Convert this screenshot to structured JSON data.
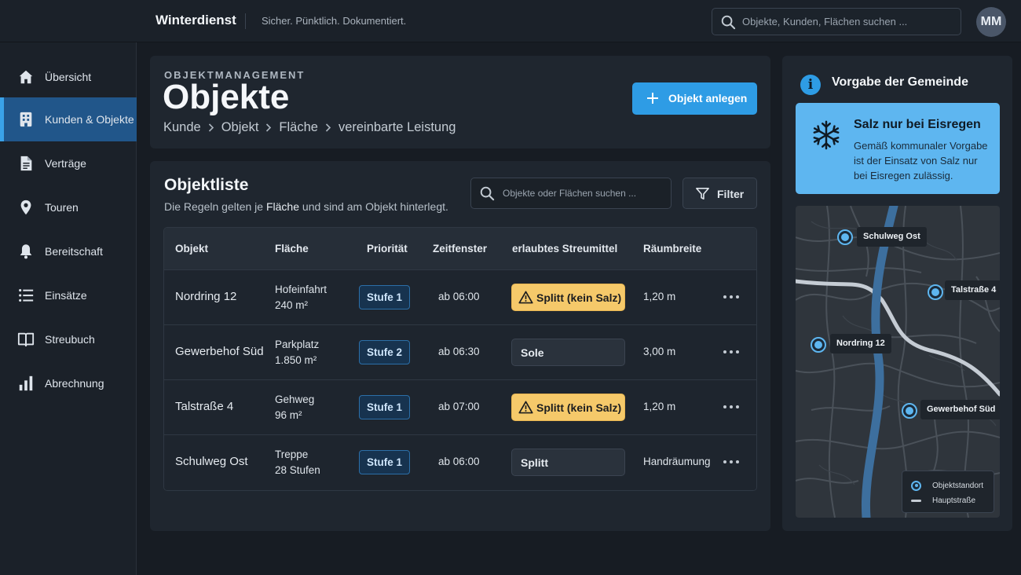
{
  "app": {
    "name": "Winterdienst",
    "tagline": "Sicher. Pünktlich. Dokumentiert.",
    "search_placeholder": "Objekte, Kunden, Flächen suchen ...",
    "avatar_initials": "MM"
  },
  "sidebar": {
    "items": [
      {
        "label": "Übersicht",
        "icon": "home-icon",
        "active": false
      },
      {
        "label": "Kunden & Objekte",
        "icon": "building-icon",
        "active": true
      },
      {
        "label": "Verträge",
        "icon": "document-icon",
        "active": false
      },
      {
        "label": "Touren",
        "icon": "map-pin-icon",
        "active": false
      },
      {
        "label": "Bereitschaft",
        "icon": "bell-icon",
        "active": false
      },
      {
        "label": "Einsätze",
        "icon": "list-icon",
        "active": false
      },
      {
        "label": "Streubuch",
        "icon": "book-icon",
        "active": false
      },
      {
        "label": "Abrechnung",
        "icon": "bar-chart-icon",
        "active": false
      }
    ]
  },
  "header": {
    "overline": "OBJEKTMANAGEMENT",
    "title": "Objekte",
    "breadcrumb": [
      "Kunde",
      "Objekt",
      "Fläche",
      "vereinbarte Leistung"
    ],
    "primary_action": "Objekt anlegen"
  },
  "object_list": {
    "title": "Objektliste",
    "subtitle_before": "Die Regeln gelten je",
    "subtitle_highlight": "Fläche",
    "subtitle_after": "und sind am Objekt hinterlegt.",
    "search_placeholder": "Objekte oder Flächen suchen ...",
    "filter_label": "Filter",
    "columns": [
      "Objekt",
      "Fläche",
      "Priorität",
      "Zeitfenster",
      "erlaubtes Streumittel",
      "Räumbreite"
    ],
    "rows": [
      {
        "object": "Nordring 12",
        "area_name": "Hofeinfahrt",
        "area_size": "240 m²",
        "priority": "Stufe 1",
        "time": "ab 06:00",
        "material": "Splitt (kein Salz)",
        "material_warning": true,
        "width": "1,20 m"
      },
      {
        "object": "Gewerbehof Süd",
        "area_name": "Parkplatz",
        "area_size": "1.850 m²",
        "priority": "Stufe 2",
        "time": "ab 06:30",
        "material": "Sole",
        "material_warning": false,
        "width": "3,00 m"
      },
      {
        "object": "Talstraße 4",
        "area_name": "Gehweg",
        "area_size": "96 m²",
        "priority": "Stufe 1",
        "time": "ab 07:00",
        "material": "Splitt (kein Salz)",
        "material_warning": true,
        "width": "1,20 m"
      },
      {
        "object": "Schulweg Ost",
        "area_name": "Treppe",
        "area_size": "28 Stufen",
        "priority": "Stufe 1",
        "time": "ab 06:00",
        "material": "Splitt",
        "material_warning": false,
        "width": "Handräumung"
      }
    ]
  },
  "right_panel": {
    "title": "Vorgabe der Gemeinde",
    "notice": {
      "title": "Salz nur bei Eisregen",
      "text": "Gemäß kommunaler Vorgabe ist der Einsatz von Salz nur bei Eisregen zulässig.",
      "icon": "snowflake-icon"
    },
    "map": {
      "markers": [
        "Schulweg Ost",
        "Talstraße 4",
        "Nordring 12",
        "Gewerbehof Süd"
      ],
      "legend": [
        "Objektstandort",
        "Hauptstraße"
      ]
    }
  },
  "colors": {
    "accent": "#2e9ce5",
    "warning": "#f5c96a",
    "notice": "#5eb6f0",
    "sidebar_active": "#21568a"
  }
}
